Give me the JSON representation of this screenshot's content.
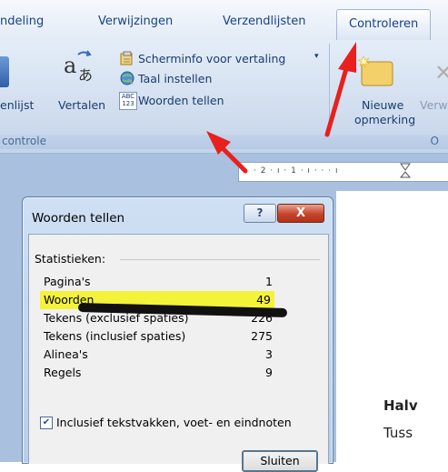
{
  "ribbon": {
    "tabs": [
      "ndeling",
      "Verwijzingen",
      "Verzendlijsten",
      "Controleren"
    ],
    "active_tab": "Controleren",
    "buttons": {
      "enlijst": "enlijst",
      "vertalen": "Vertalen",
      "scherminfo": "Scherminfo voor vertaling",
      "taal": "Taal instellen",
      "woorden_tellen": "Woorden tellen",
      "nieuwe_1": "Nieuwe",
      "nieuwe_2": "opmerking",
      "verw": "Verw",
      "abc_top": "ABC",
      "abc_bottom": "123"
    },
    "groups": {
      "left": "controle",
      "right": "O"
    }
  },
  "ruler": {
    "marks": "· 2 · ı · 1 · ı · ·   · ı"
  },
  "dialog": {
    "title": "Woorden tellen",
    "help": "?",
    "close": "X",
    "section": "Statistieken:",
    "rows": [
      {
        "label": "Pagina's",
        "value": "1"
      },
      {
        "label": "Woorden",
        "value": "49"
      },
      {
        "label": "Tekens (exclusief spaties)",
        "value": "226"
      },
      {
        "label": "Tekens (inclusief spaties)",
        "value": "275"
      },
      {
        "label": "Alinea's",
        "value": "3"
      },
      {
        "label": "Regels",
        "value": "9"
      }
    ],
    "checkbox_label": "Inclusief tekstvakken, voet- en eindnoten",
    "checkbox_checked": true,
    "close_button": "Sluiten"
  },
  "document": {
    "line1": "Halv",
    "line2": "Tuss"
  },
  "colors": {
    "highlight": "#f5f23a",
    "arrow": "#e8201e"
  }
}
